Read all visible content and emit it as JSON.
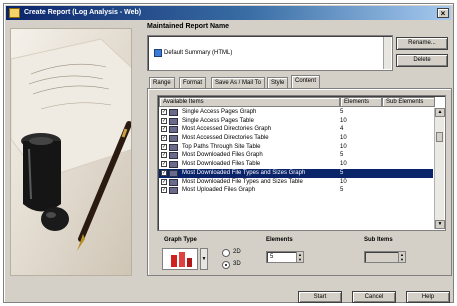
{
  "window": {
    "title": "Create Report (Log Analysis - Web)",
    "close_glyph": "×"
  },
  "report": {
    "section_label": "Maintained Report Name",
    "selected_report": "Default Summary (HTML)",
    "buttons": {
      "rename": "Rename...",
      "delete": "Delete"
    }
  },
  "tabs": [
    "Range",
    "Format",
    "Save As / Mail To",
    "Style",
    "Content"
  ],
  "active_tab": "Content",
  "content": {
    "columns": [
      "Available Items",
      "Elements",
      "Sub Elements"
    ],
    "rows": [
      {
        "name": "Single Access Pages Graph",
        "elements": "5",
        "checked": true,
        "selected": false
      },
      {
        "name": "Single Access Pages Table",
        "elements": "10",
        "checked": true,
        "selected": false
      },
      {
        "name": "Most Accessed Directories Graph",
        "elements": "4",
        "checked": true,
        "selected": false
      },
      {
        "name": "Most Accessed Directories Table",
        "elements": "10",
        "checked": true,
        "selected": false
      },
      {
        "name": "Top Paths Through Site Table",
        "elements": "10",
        "checked": true,
        "selected": false
      },
      {
        "name": "Most Downloaded Files Graph",
        "elements": "5",
        "checked": true,
        "selected": false
      },
      {
        "name": "Most Downloaded Files Table",
        "elements": "10",
        "checked": true,
        "selected": false
      },
      {
        "name": "Most Downloaded File Types and Sizes Graph",
        "elements": "5",
        "checked": true,
        "selected": true
      },
      {
        "name": "Most Downloaded File Types and Sizes Table",
        "elements": "10",
        "checked": true,
        "selected": false
      },
      {
        "name": "Most Uploaded Files Graph",
        "elements": "5",
        "checked": true,
        "selected": false
      }
    ],
    "graph_type_label": "Graph Type",
    "graph_mode_2d": "2D",
    "graph_mode_3d": "3D",
    "elements_label": "Elements",
    "elements_value": "5",
    "sub_items_label": "Sub Items",
    "sub_items_value": ""
  },
  "footer": {
    "start": "Start",
    "cancel": "Cancel",
    "help": "Help"
  },
  "colors": {
    "title_start": "#0a246a",
    "selection": "#0a246a",
    "dialog_face": "#d4d0c8"
  }
}
